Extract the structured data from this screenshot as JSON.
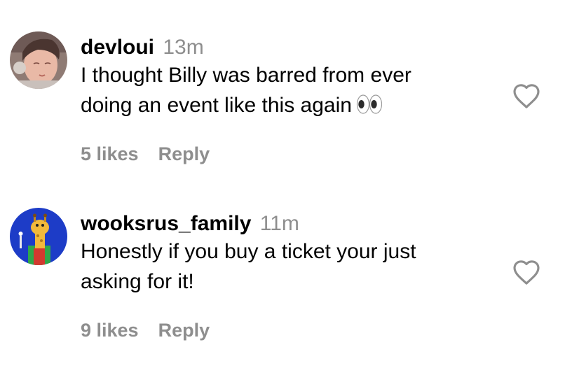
{
  "comments": [
    {
      "username": "devloui",
      "time": "13m",
      "text_line1": "I thought Billy was barred from ever",
      "text_line2": "doing an event like this again",
      "emoji": "eyes",
      "likes": "5 likes",
      "reply": "Reply",
      "like_icon": "heart-outline-icon"
    },
    {
      "username": "wooksrus_family",
      "time": "11m",
      "text_line1": "Honestly if you buy a ticket your just",
      "text_line2": "asking for it!",
      "likes": "9 likes",
      "reply": "Reply",
      "like_icon": "heart-outline-icon"
    }
  ],
  "colors": {
    "text": "#000000",
    "secondary": "#8e8e8e",
    "avatar2_bg": "#1d3cc7"
  }
}
